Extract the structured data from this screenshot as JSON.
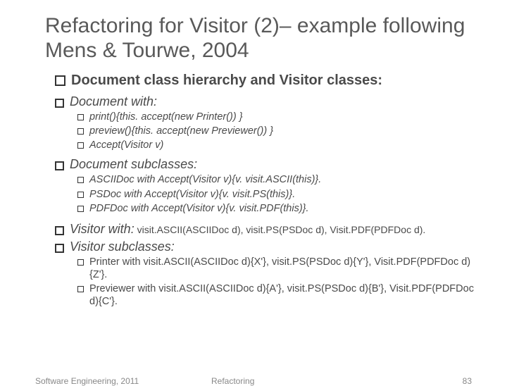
{
  "title": "Refactoring for Visitor (2)–  example following Mens & Tourwe, 2004",
  "lvl1": "Document class hierarchy and Visitor classes:",
  "doc_with": "Document with:",
  "doc_with_items": [
    " print(){this. accept(new Printer()) }",
    " preview(){this. accept(new Previewer()) }",
    "Accept(Visitor v)"
  ],
  "doc_sub": "Document subclasses:",
  "doc_sub_items": [
    "ASCIIDoc with Accept(Visitor v){v. visit.ASCII(this)}.",
    "PSDoc with Accept(Visitor v){v. visit.PS(this)}.",
    "PDFDoc with Accept(Visitor v){v. visit.PDF(this)}."
  ],
  "vis_with_label": "Visitor with:",
  "vis_with_sig": " visit.ASCII(ASCIIDoc d), visit.PS(PSDoc d), Visit.PDF(PDFDoc d).",
  "vis_sub": "Visitor subclasses:",
  "vis_sub_items": [
    "Printer with visit.ASCII(ASCIIDoc d){X'}, visit.PS(PSDoc d){Y'}, Visit.PDF(PDFDoc d){Z'}.",
    "Previewer with visit.ASCII(ASCIIDoc d){A'}, visit.PS(PSDoc d){B'}, Visit.PDF(PDFDoc d){C'}."
  ],
  "footer": {
    "left": "Software Engineering, 2011",
    "center": "Refactoring",
    "right": "83"
  }
}
